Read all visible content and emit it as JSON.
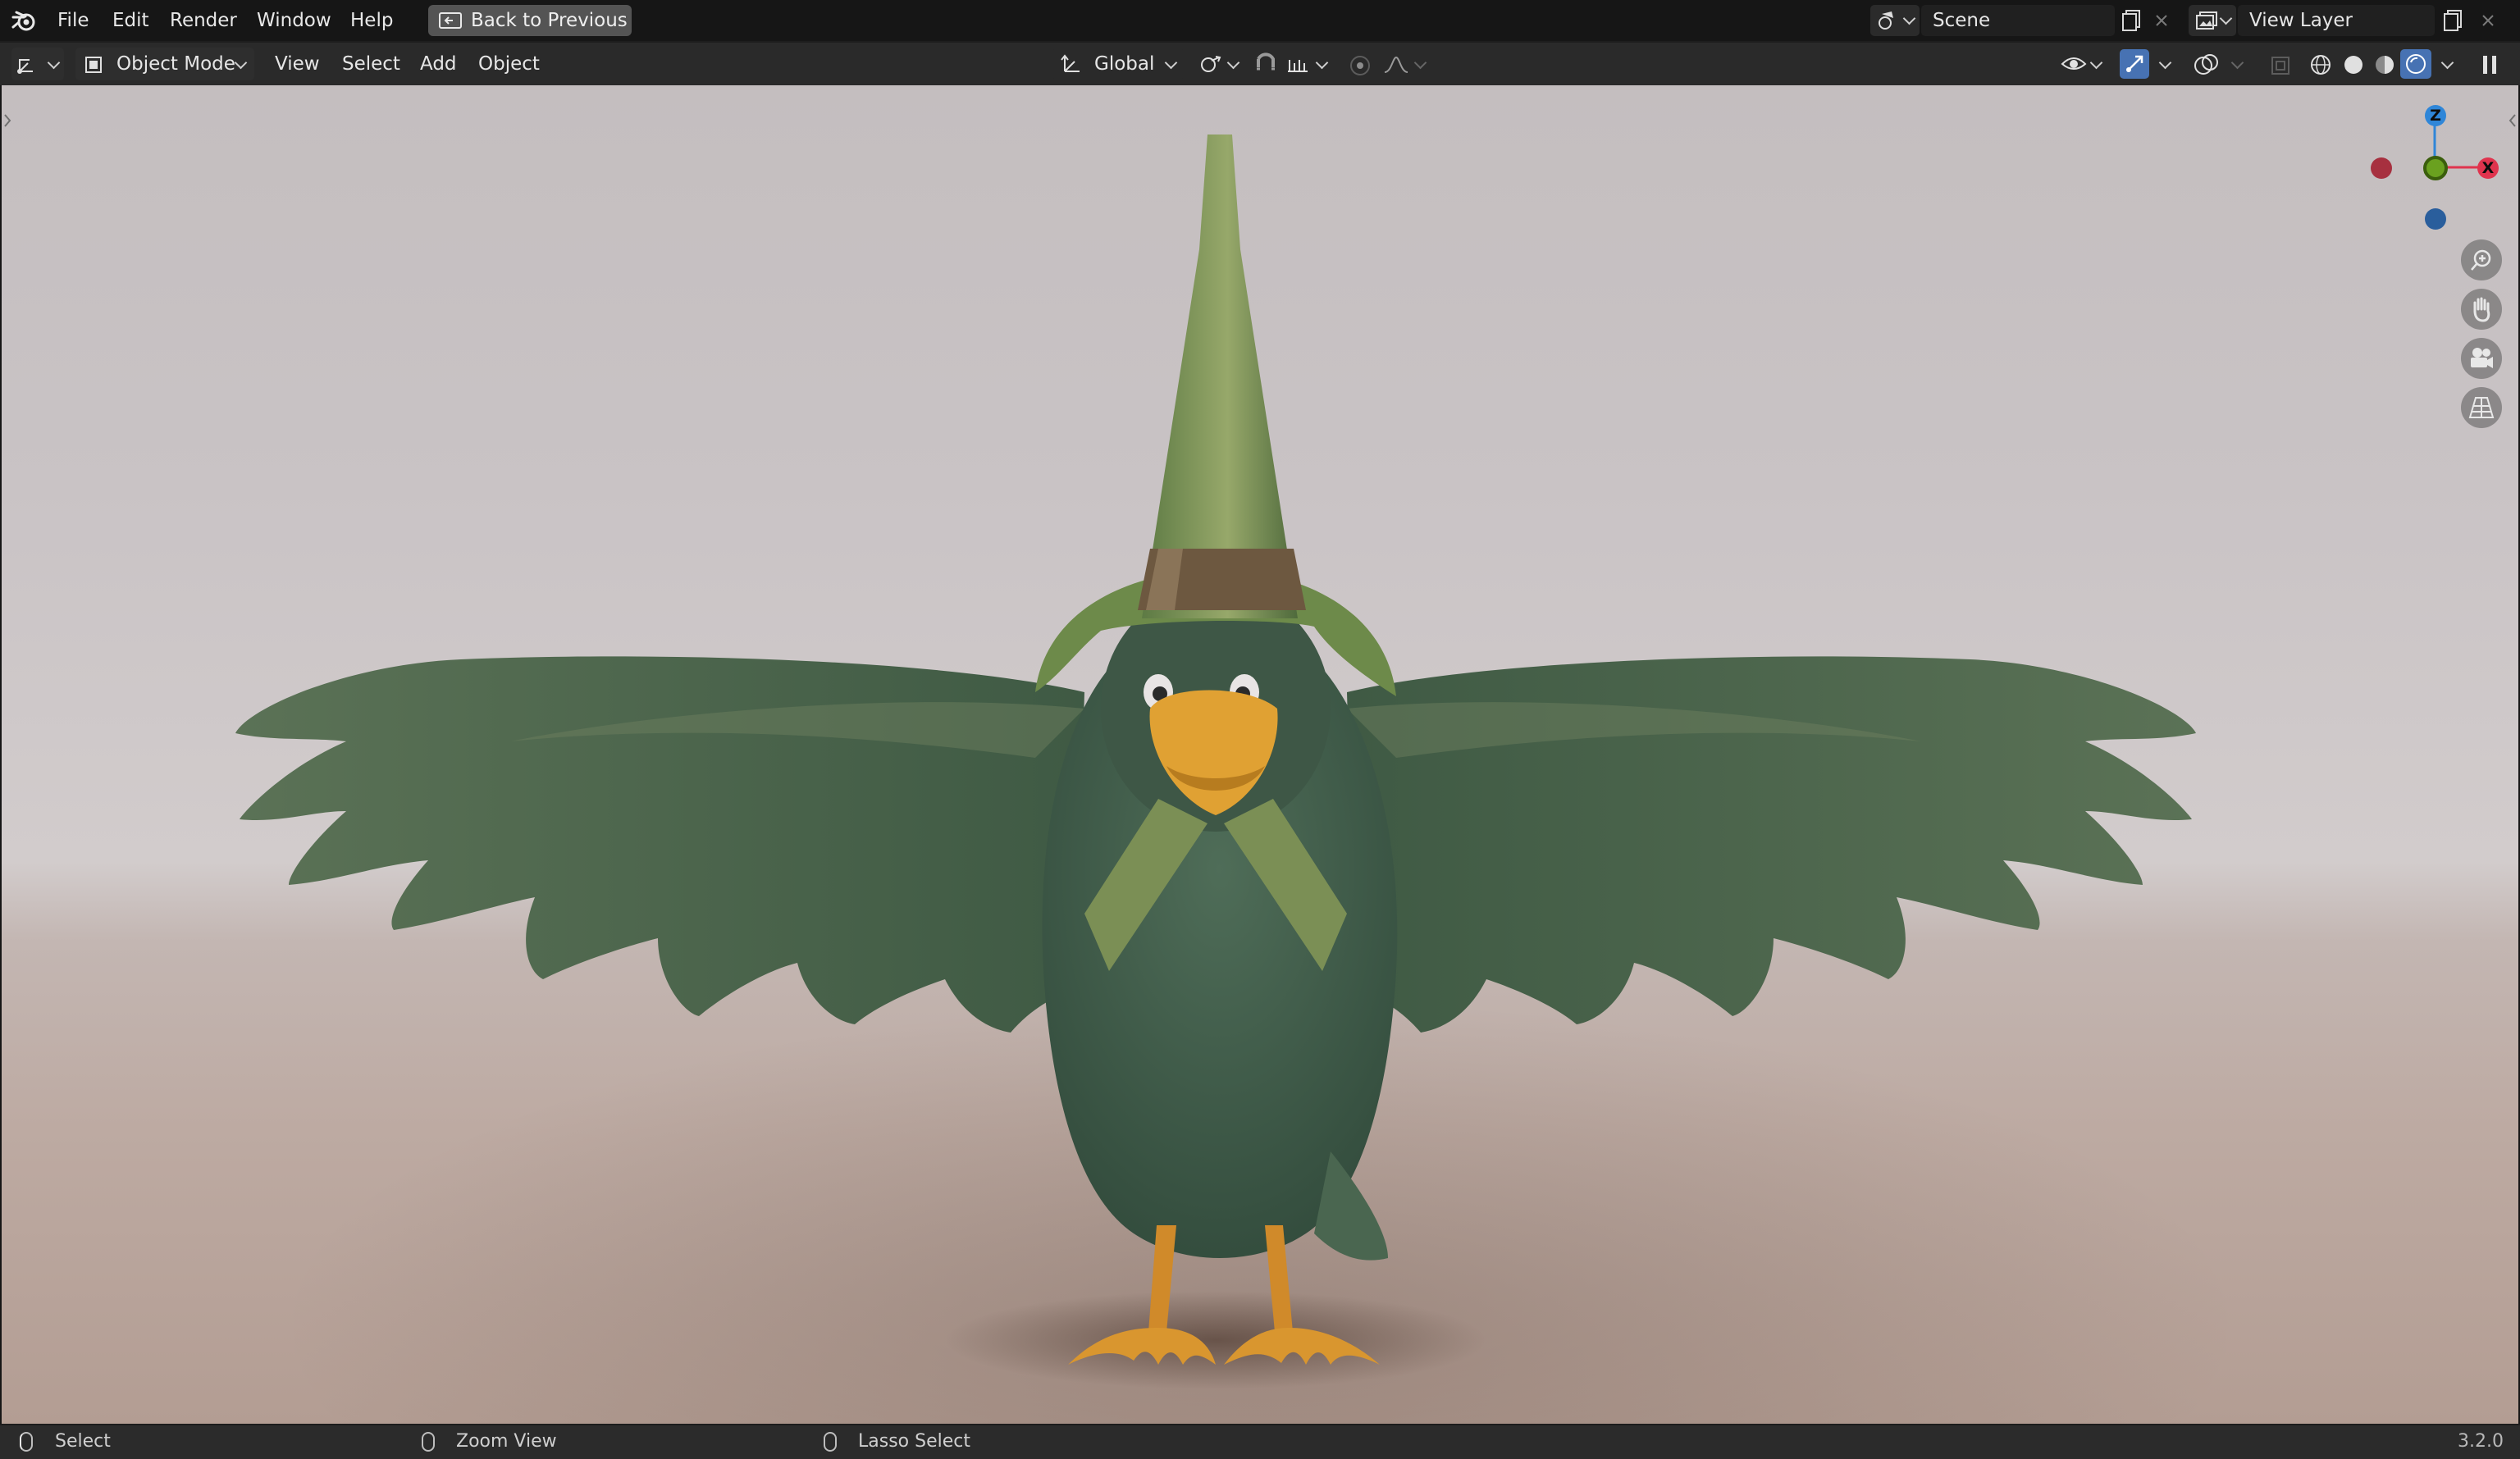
{
  "menubar": {
    "items": [
      "File",
      "Edit",
      "Render",
      "Window",
      "Help"
    ],
    "back_button": "Back to Previous",
    "scene_name": "Scene",
    "view_layer_name": "View Layer"
  },
  "header": {
    "mode": "Object Mode",
    "menus": [
      "View",
      "Select",
      "Add",
      "Object"
    ],
    "transform_orientation": "Global"
  },
  "gizmo": {
    "axes": [
      "Z",
      "X"
    ],
    "colors": {
      "x": "#e0344e",
      "y": "#6aa11f",
      "z": "#2f86d8"
    }
  },
  "viewport": {
    "nav_icons": [
      "zoom-icon",
      "hand-pan-icon",
      "camera-icon",
      "grid-view-icon"
    ]
  },
  "statusbar": {
    "hints": [
      "Select",
      "Zoom View",
      "Lasso Select"
    ],
    "version": "3.2.0"
  }
}
